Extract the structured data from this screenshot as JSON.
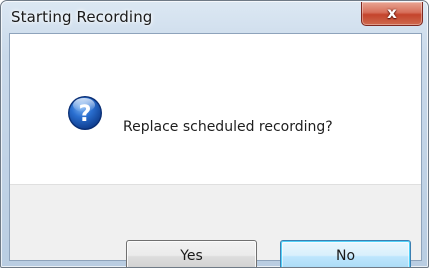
{
  "window": {
    "title": "Starting Recording",
    "close_glyph": "x"
  },
  "message": {
    "icon": "question-icon",
    "text": "Replace scheduled recording?"
  },
  "buttons": {
    "yes_label": "Yes",
    "no_label": "No"
  },
  "colors": {
    "icon_blue": "#1f5fbf",
    "close_red": "#c4442c",
    "default_button_border": "#3c7fb1"
  }
}
